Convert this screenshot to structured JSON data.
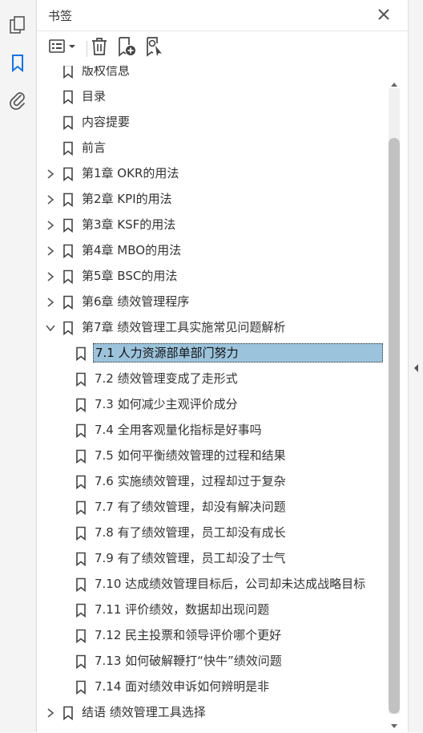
{
  "panel": {
    "title": "书签"
  },
  "toolbar": {
    "buttons": [
      "options-menu-icon",
      "delete-icon",
      "new-bookmark-icon",
      "find-current-bookmark-icon"
    ]
  },
  "bookmarks": [
    {
      "label": "版权信息",
      "level": 0,
      "expander": "none"
    },
    {
      "label": "目录",
      "level": 0,
      "expander": "none"
    },
    {
      "label": "内容提要",
      "level": 0,
      "expander": "none"
    },
    {
      "label": "前言",
      "level": 0,
      "expander": "none"
    },
    {
      "label": "第1章 OKR的用法",
      "level": 0,
      "expander": "collapsed"
    },
    {
      "label": "第2章 KPI的用法",
      "level": 0,
      "expander": "collapsed"
    },
    {
      "label": "第3章 KSF的用法",
      "level": 0,
      "expander": "collapsed"
    },
    {
      "label": "第4章 MBO的用法",
      "level": 0,
      "expander": "collapsed"
    },
    {
      "label": "第5章 BSC的用法",
      "level": 0,
      "expander": "collapsed"
    },
    {
      "label": "第6章 绩效管理程序",
      "level": 0,
      "expander": "collapsed"
    },
    {
      "label": "第7章 绩效管理工具实施常见问题解析",
      "level": 0,
      "expander": "expanded"
    },
    {
      "label": "7.1 人力资源部单部门努力",
      "level": 1,
      "expander": "none",
      "selected": true
    },
    {
      "label": "7.2 绩效管理变成了走形式",
      "level": 1,
      "expander": "none"
    },
    {
      "label": "7.3 如何减少主观评价成分",
      "level": 1,
      "expander": "none"
    },
    {
      "label": "7.4 全用客观量化指标是好事吗",
      "level": 1,
      "expander": "none"
    },
    {
      "label": "7.5 如何平衡绩效管理的过程和结果",
      "level": 1,
      "expander": "none"
    },
    {
      "label": "7.6 实施绩效管理，过程却过于复杂",
      "level": 1,
      "expander": "none"
    },
    {
      "label": "7.7 有了绩效管理，却没有解决问题",
      "level": 1,
      "expander": "none"
    },
    {
      "label": "7.8 有了绩效管理，员工却没有成长",
      "level": 1,
      "expander": "none"
    },
    {
      "label": "7.9 有了绩效管理，员工却没了士气",
      "level": 1,
      "expander": "none"
    },
    {
      "label": "7.10 达成绩效管理目标后，公司却未达成战略目标",
      "level": 1,
      "expander": "none"
    },
    {
      "label": "7.11 评价绩效，数据却出现问题",
      "level": 1,
      "expander": "none"
    },
    {
      "label": "7.12 民主投票和领导评价哪个更好",
      "level": 1,
      "expander": "none"
    },
    {
      "label": "7.13 如何破解鞭打“快牛”绩效问题",
      "level": 1,
      "expander": "none"
    },
    {
      "label": "7.14 面对绩效申诉如何辨明是非",
      "level": 1,
      "expander": "none"
    },
    {
      "label": "结语 绩效管理工具选择",
      "level": 0,
      "expander": "collapsed"
    }
  ],
  "colors": {
    "selection": "#9cc3dc",
    "accent": "#1473e6",
    "scroll_thumb": "#c1c1c1"
  }
}
